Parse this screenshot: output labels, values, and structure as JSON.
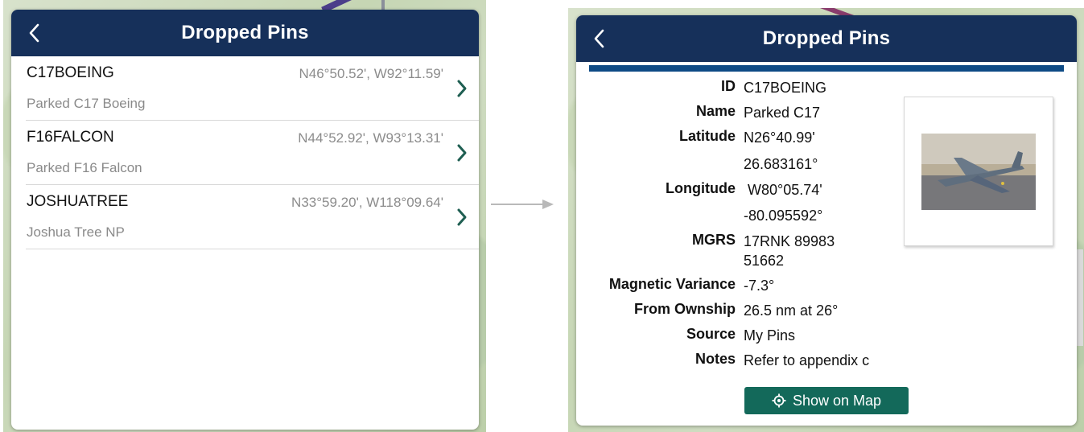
{
  "list_screen": {
    "title": "Dropped Pins",
    "pins": [
      {
        "id": "C17BOEING",
        "coords": "N46°50.52', W92°11.59'",
        "description": "Parked C17 Boeing"
      },
      {
        "id": "F16FALCON",
        "coords": "N44°52.92', W93°13.31'",
        "description": "Parked F16 Falcon"
      },
      {
        "id": "JOSHUATREE",
        "coords": "N33°59.20', W118°09.64'",
        "description": "Joshua Tree NP"
      }
    ]
  },
  "detail_screen": {
    "title": "Dropped Pins",
    "fields": {
      "id": {
        "label": "ID",
        "value": "C17BOEING"
      },
      "name": {
        "label": "Name",
        "value": "Parked C17"
      },
      "latitude": {
        "label": "Latitude",
        "value": "N26°40.99'",
        "decimal": "26.683161°"
      },
      "longitude": {
        "label": "Longitude",
        "value": " W80°05.74'",
        "decimal": "-80.095592°"
      },
      "mgrs": {
        "label": "MGRS",
        "value_line1": "17RNK 89983",
        "value_line2": "51662"
      },
      "magnetic_variance": {
        "label": "Magnetic Variance",
        "value": "-7.3°"
      },
      "from_ownship": {
        "label": "From Ownship",
        "value": "26.5 nm at 26°"
      },
      "source": {
        "label": "Source",
        "value": "My Pins"
      },
      "notes": {
        "label": "Notes",
        "value": "Refer to appendix c"
      }
    },
    "show_on_map_label": "Show on Map"
  },
  "icons": {
    "back": "chevron-left-icon",
    "row_disclosure": "chevron-right-icon",
    "flow": "arrow-right-icon",
    "locate": "target-icon"
  },
  "colors": {
    "nav_bar": "#16305a",
    "accent_bar": "#0e4a85",
    "chevron": "#1f5f52",
    "button": "#13695a"
  }
}
